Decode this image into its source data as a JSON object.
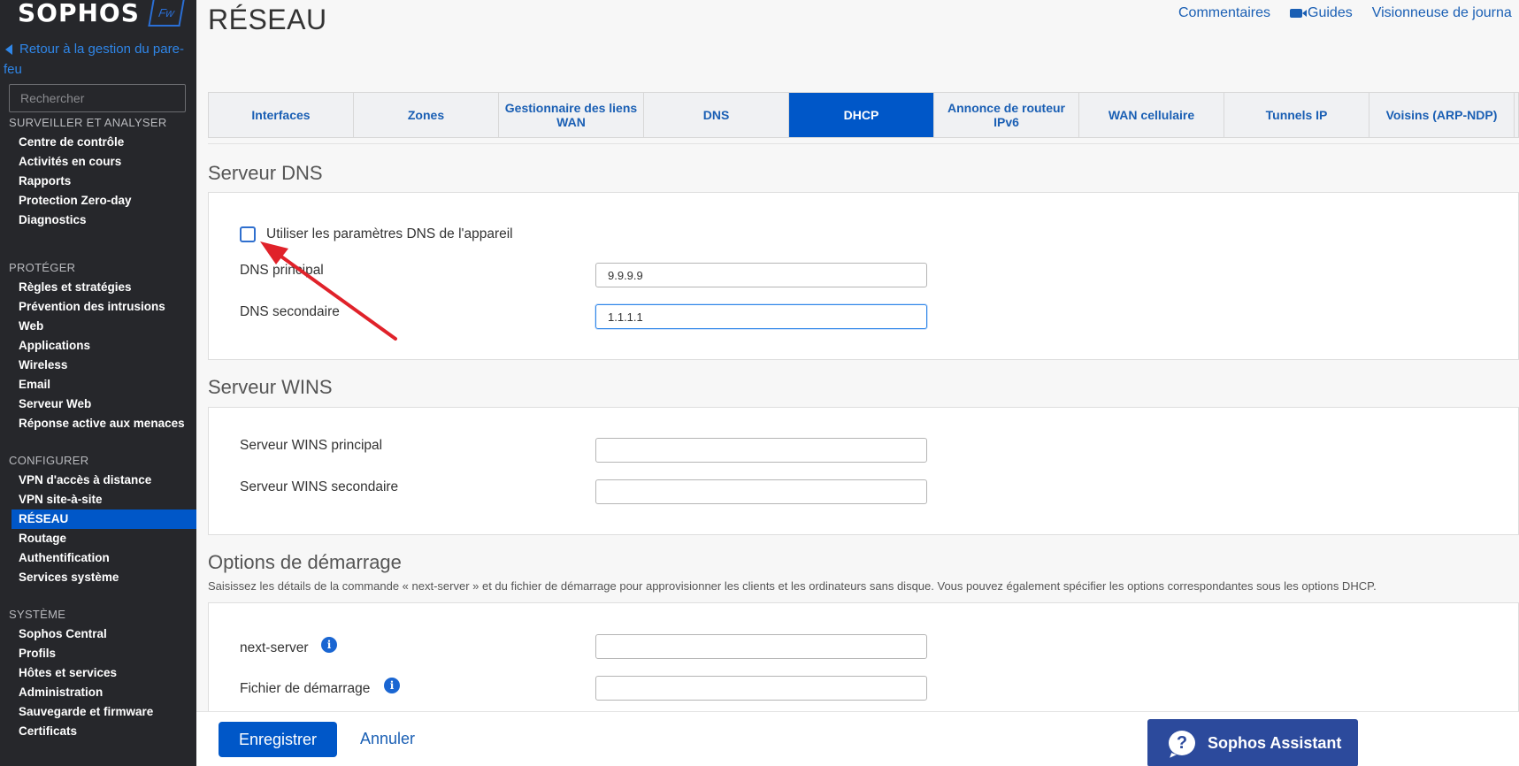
{
  "app": {
    "logo": "SOPHOS",
    "logo_badge": "Fw",
    "back_link": "Retour à la gestion du pare-feu",
    "search_placeholder": "Rechercher"
  },
  "sidebar": {
    "sections": [
      {
        "heading": "SURVEILLER ET ANALYSER",
        "items": [
          "Centre de contrôle",
          "Activités en cours",
          "Rapports",
          "Protection Zero-day",
          "Diagnostics"
        ]
      },
      {
        "heading": "PROTÉGER",
        "items": [
          "Règles et stratégies",
          "Prévention des intrusions",
          "Web",
          "Applications",
          "Wireless",
          "Email",
          "Serveur Web",
          "Réponse active aux menaces"
        ]
      },
      {
        "heading": "CONFIGURER",
        "items": [
          "VPN d'accès à distance",
          "VPN site-à-site",
          "RÉSEAU",
          "Routage",
          "Authentification",
          "Services système"
        ]
      },
      {
        "heading": "SYSTÈME",
        "items": [
          "Sophos Central",
          "Profils",
          "Hôtes et services",
          "Administration",
          "Sauvegarde et firmware",
          "Certificats"
        ]
      }
    ],
    "active_item": "RÉSEAU"
  },
  "header": {
    "title": "RÉSEAU",
    "links": {
      "feedback": "Commentaires",
      "guides": "Guides",
      "log_viewer": "Visionneuse de journa"
    }
  },
  "tabs": [
    {
      "label": "Interfaces",
      "active": false
    },
    {
      "label": "Zones",
      "active": false
    },
    {
      "label": "Gestionnaire des liens WAN",
      "active": false
    },
    {
      "label": "DNS",
      "active": false
    },
    {
      "label": "DHCP",
      "active": true
    },
    {
      "label": "Annonce de routeur IPv6",
      "active": false
    },
    {
      "label": "WAN cellulaire",
      "active": false
    },
    {
      "label": "Tunnels IP",
      "active": false
    },
    {
      "label": "Voisins (ARP-NDP)",
      "active": false
    }
  ],
  "dns_server": {
    "title": "Serveur DNS",
    "use_device_dns_label": "Utiliser les paramètres DNS de l'appareil",
    "use_device_dns_checked": false,
    "primary_label": "DNS principal",
    "primary_value": "9.9.9.9",
    "secondary_label": "DNS secondaire",
    "secondary_value": "1.1.1.1"
  },
  "wins_server": {
    "title": "Serveur WINS",
    "primary_label": "Serveur WINS principal",
    "primary_value": "",
    "secondary_label": "Serveur WINS secondaire",
    "secondary_value": ""
  },
  "boot_options": {
    "title": "Options de démarrage",
    "description": "Saisissez les détails de la commande « next-server » et du fichier de démarrage pour approvisionner les clients et les ordinateurs sans disque. Vous pouvez également spécifier les options correspondantes sous les options DHCP.",
    "next_server_label": "next-server",
    "next_server_value": "",
    "boot_file_label": "Fichier de démarrage",
    "boot_file_value": ""
  },
  "footer": {
    "save_label": "Enregistrer",
    "cancel_label": "Annuler",
    "assistant_label": "Sophos Assistant"
  },
  "colors": {
    "sidebar_bg": "#26272b",
    "accent": "#0057c8",
    "link": "#1a5fb4",
    "annotation_arrow": "#e0222a"
  }
}
